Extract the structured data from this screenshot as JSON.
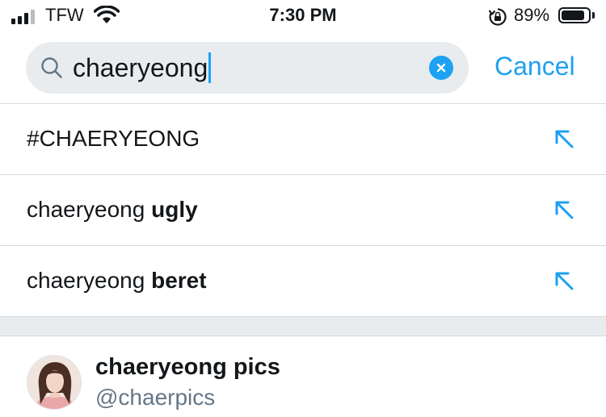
{
  "status_bar": {
    "carrier": "TFW",
    "time": "7:30 PM",
    "battery_percent": "89%",
    "battery_level": 0.89,
    "signal_bars_active": 3,
    "signal_bars_total": 4
  },
  "search": {
    "query": "chaeryeong",
    "cancel_label": "Cancel"
  },
  "suggestions": [
    {
      "prefix": "#CHAERYEONG",
      "bold": ""
    },
    {
      "prefix": "chaeryeong ",
      "bold": "ugly"
    },
    {
      "prefix": "chaeryeong ",
      "bold": "beret"
    }
  ],
  "account": {
    "name": "chaeryeong pics",
    "handle": "@chaerpics"
  },
  "colors": {
    "accent": "#1da1f2",
    "text_primary": "#14171a",
    "text_secondary": "#657786",
    "search_bg": "#e8ecef"
  },
  "icons": {
    "search": "magnifier-icon",
    "clear": "clear-x-icon",
    "suggestion_arrow": "arrow-up-left-icon"
  }
}
